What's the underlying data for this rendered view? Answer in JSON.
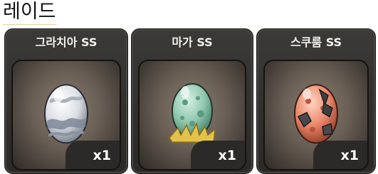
{
  "page": {
    "title": "레이드"
  },
  "cards": [
    {
      "name": "그라치아 SS",
      "quantity": "x1",
      "icon": "white-blue-egg-icon"
    },
    {
      "name": "마가 SS",
      "quantity": "x1",
      "icon": "green-spotted-egg-on-straw-icon"
    },
    {
      "name": "스쿠룸 SS",
      "quantity": "x1",
      "icon": "red-cracked-egg-icon"
    }
  ],
  "colors": {
    "card_bg": "#33322f",
    "slot_bg": "#6a5f55",
    "text": "#f4f1ea"
  }
}
